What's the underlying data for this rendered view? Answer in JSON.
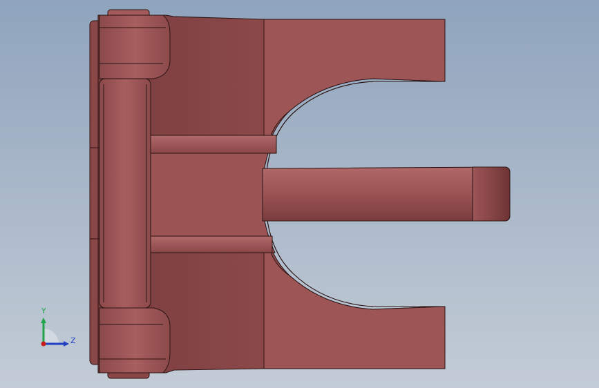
{
  "triad": {
    "y_label": "Y",
    "z_label": "Z"
  },
  "colors": {
    "background_top": "#8fa4bd",
    "background_bottom": "#c3ccd6",
    "part_face": "#9e5556",
    "part_dark": "#7a3c3d",
    "part_edge": "#2a1414",
    "axis_y": "#22a34a",
    "axis_z": "#1f3fc2",
    "axis_x": "#c81e1e"
  }
}
